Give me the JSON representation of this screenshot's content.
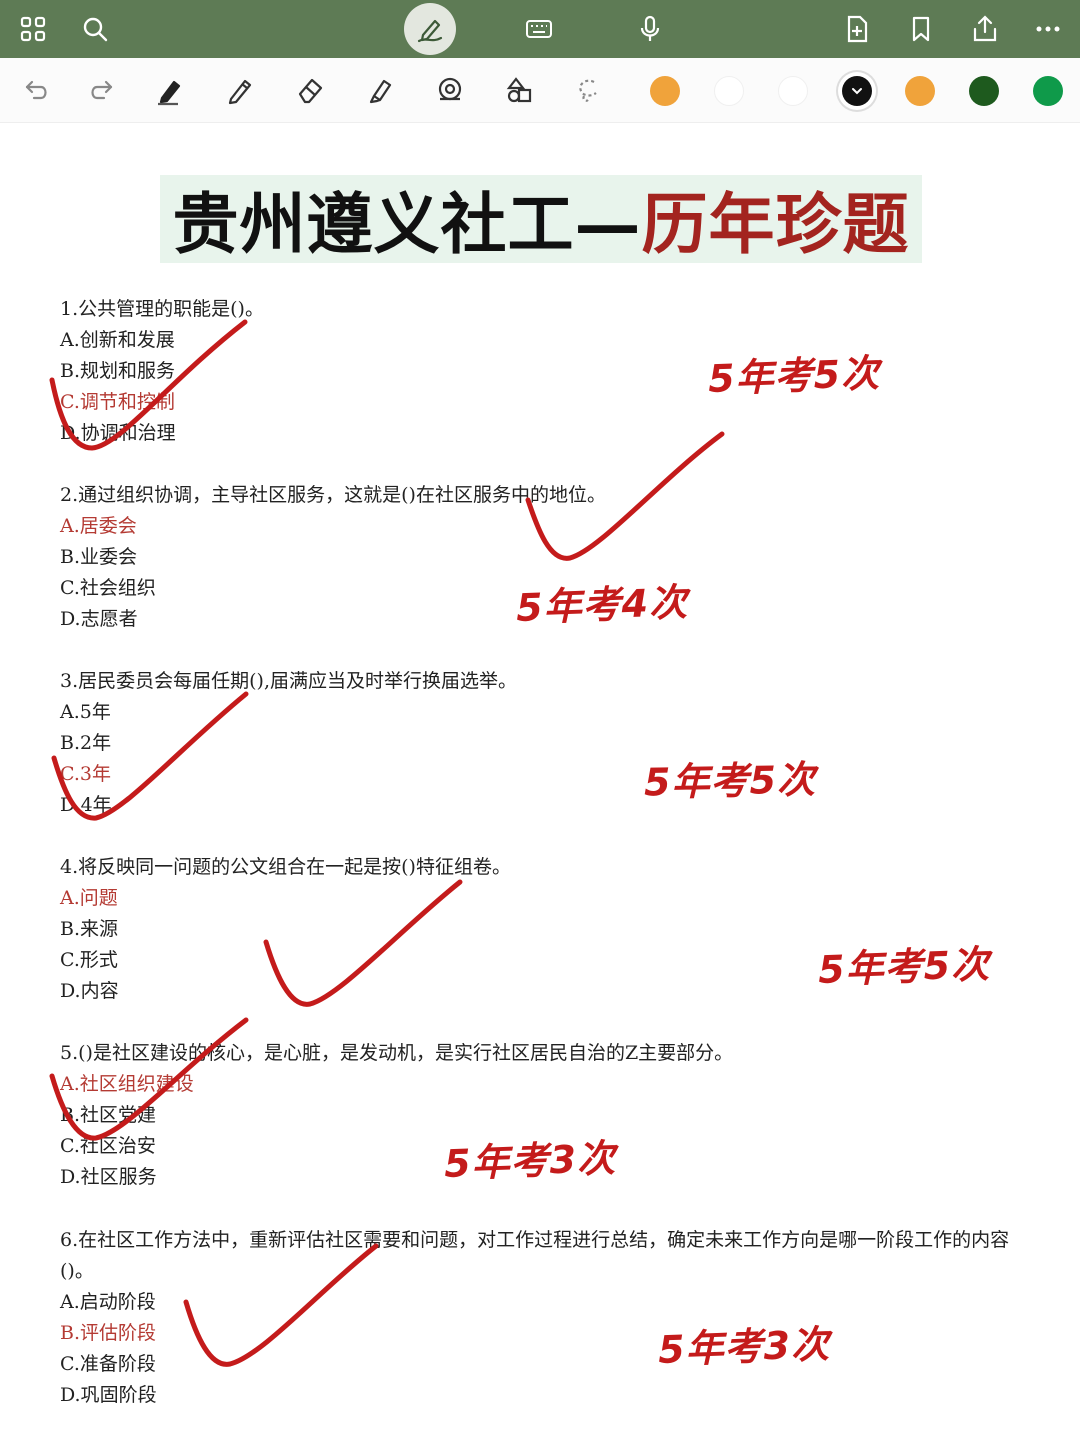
{
  "colors": {
    "topbar": "#5e7b55",
    "title_accent": "#a3241f",
    "answer": "#b43a33",
    "annotation": "#c41b1b",
    "swatches": [
      "#f0a33b",
      "#ffffff",
      "#ffffff",
      "#111111",
      "#f0a33b",
      "#1e5a1e",
      "#0f9a4a"
    ]
  },
  "topbar": {
    "icons": [
      "grid-icon",
      "search-icon",
      "pen-mode-icon",
      "keyboard-icon",
      "microphone-icon",
      "add-page-icon",
      "bookmark-icon",
      "share-icon",
      "more-icon"
    ]
  },
  "toolbar": {
    "tools": [
      "undo-icon",
      "redo-icon",
      "fountain-pen-icon",
      "pencil-icon",
      "eraser-icon",
      "highlighter-icon",
      "tape-icon",
      "shapes-icon",
      "lasso-icon"
    ],
    "selected_color": "#111111"
  },
  "doc": {
    "title_part1": "贵州遵义社工—",
    "title_part2": "历年珍题",
    "questions": [
      {
        "stem": "1.公共管理的职能是()。",
        "options": [
          "A.创新和发展",
          "B.规划和服务",
          "C.调节和控制",
          "D.协调和治理"
        ],
        "answer_index": 2,
        "note": "5年考5次"
      },
      {
        "stem": "2.通过组织协调，主导社区服务，这就是()在社区服务中的地位。",
        "options": [
          "A.居委会",
          "B.业委会",
          "C.社会组织",
          "D.志愿者"
        ],
        "answer_index": 0,
        "note": "5年考4次"
      },
      {
        "stem": "3.居民委员会每届任期(),届满应当及时举行换届选举。",
        "options": [
          "A.5年",
          "B.2年",
          "C.3年",
          "D.4年"
        ],
        "answer_index": 2,
        "note": "5年考5次"
      },
      {
        "stem": "4.将反映同一问题的公文组合在一起是按()特征组卷。",
        "options": [
          "A.问题",
          "B.来源",
          "C.形式",
          "D.内容"
        ],
        "answer_index": 0,
        "note": "5年考5次"
      },
      {
        "stem": "5.()是社区建设的核心，是心脏，是发动机，是实行社区居民自治的Z主要部分。",
        "options": [
          "A.社区组织建设",
          "B.社区党建",
          "C.社区治安",
          "D.社区服务"
        ],
        "answer_index": 0,
        "note": "5年考3次"
      },
      {
        "stem": "6.在社区工作方法中，重新评估社区需要和问题，对工作过程进行总结，确定未来工作方向是哪一阶段工作的内容()。",
        "options": [
          "A.启动阶段",
          "B.评估阶段",
          "C.准备阶段",
          "D.巩固阶段"
        ],
        "answer_index": 1,
        "note": "5年考3次"
      }
    ]
  }
}
